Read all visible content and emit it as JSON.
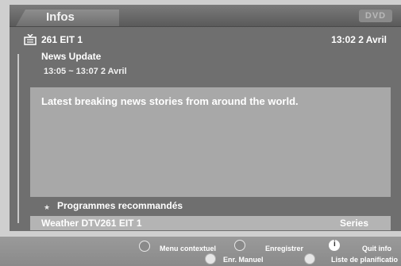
{
  "header": {
    "title": "Infos",
    "logo_text": "DVD"
  },
  "info": {
    "channel": "261 EIT 1",
    "current_datetime": "13:02 2 Avril",
    "program_title": "News Update",
    "program_time": "13:05 ~ 13:07 2 Avril",
    "description": "Latest breaking news stories from around the world."
  },
  "recommended": {
    "label": "Programmes recommandés",
    "program": "Weather DTV261 EIT 1",
    "category": "Series"
  },
  "footer": {
    "menu_contextuel": "Menu contextuel",
    "enregistrer": "Enregistrer",
    "quit_info": "Quit info",
    "enr_manuel": "Enr. Manuel",
    "liste_planification": "Liste de planificatio"
  }
}
